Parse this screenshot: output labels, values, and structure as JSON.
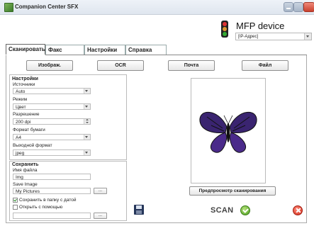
{
  "window": {
    "title": "Companion Center SFX"
  },
  "device": {
    "name": "MFP device",
    "address": "[IP-Адрес]"
  },
  "tabs": [
    {
      "label": "Сканировать"
    },
    {
      "label": "Факс"
    },
    {
      "label": "Настройки"
    },
    {
      "label": "Справка"
    }
  ],
  "scan_modes": [
    "Изображ.",
    "OCR",
    "Почта",
    "Файл"
  ],
  "settings": {
    "title": "Настройки",
    "source": {
      "label": "Источники",
      "value": "Auto"
    },
    "mode": {
      "label": "Режим",
      "value": "Цвет"
    },
    "resolution": {
      "label": "Разрешение",
      "value": "200 dpi"
    },
    "paper": {
      "label": "Формат бумаги",
      "value": "A4"
    },
    "output": {
      "label": "Выходной формат",
      "value": "jpeg"
    }
  },
  "save": {
    "title": "Сохранить",
    "filename": {
      "label": "Имя файла",
      "value": "Img"
    },
    "save_image": {
      "label": "Save Image",
      "value": "My Pictures",
      "browse": "..."
    },
    "date_folder": {
      "label": "Сохранить в папку с датой",
      "checked": true
    },
    "open_with": {
      "label": "Открыть с помощью",
      "checked": false,
      "value": "",
      "browse": "..."
    }
  },
  "preview": {
    "button": "Предпросмотр сканирования"
  },
  "actions": {
    "scan": "SCAN"
  }
}
